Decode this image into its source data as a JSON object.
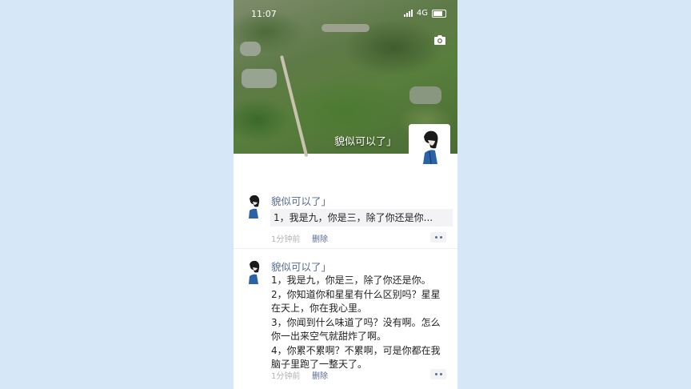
{
  "status_bar": {
    "time": "11:07",
    "network": "4G"
  },
  "cover": {
    "user_name": "貌似可以了」"
  },
  "posts": [
    {
      "author": "貌似可以了」",
      "content": "1，我是九，你是三，除了你还是你...",
      "time": "1分钟前",
      "delete_label": "删除"
    },
    {
      "author": "貌似可以了」",
      "content": "1，我是九，你是三，除了你还是你。\n2，你知道你和星星有什么区别吗？星星在天上，你在我心里。\n3，你闻到什么味道了吗？没有啊。怎么你一出来空气就甜炸了啊。\n4，你累不累啊？不累啊，可是你都在我脑子里跑了一整天了。",
      "time": "1分钟前",
      "delete_label": "删除"
    }
  ],
  "colors": {
    "link": "#576b95",
    "page_background": "#d6e8f8"
  },
  "icons": {
    "camera": "camera-icon",
    "more": "more-icon"
  }
}
